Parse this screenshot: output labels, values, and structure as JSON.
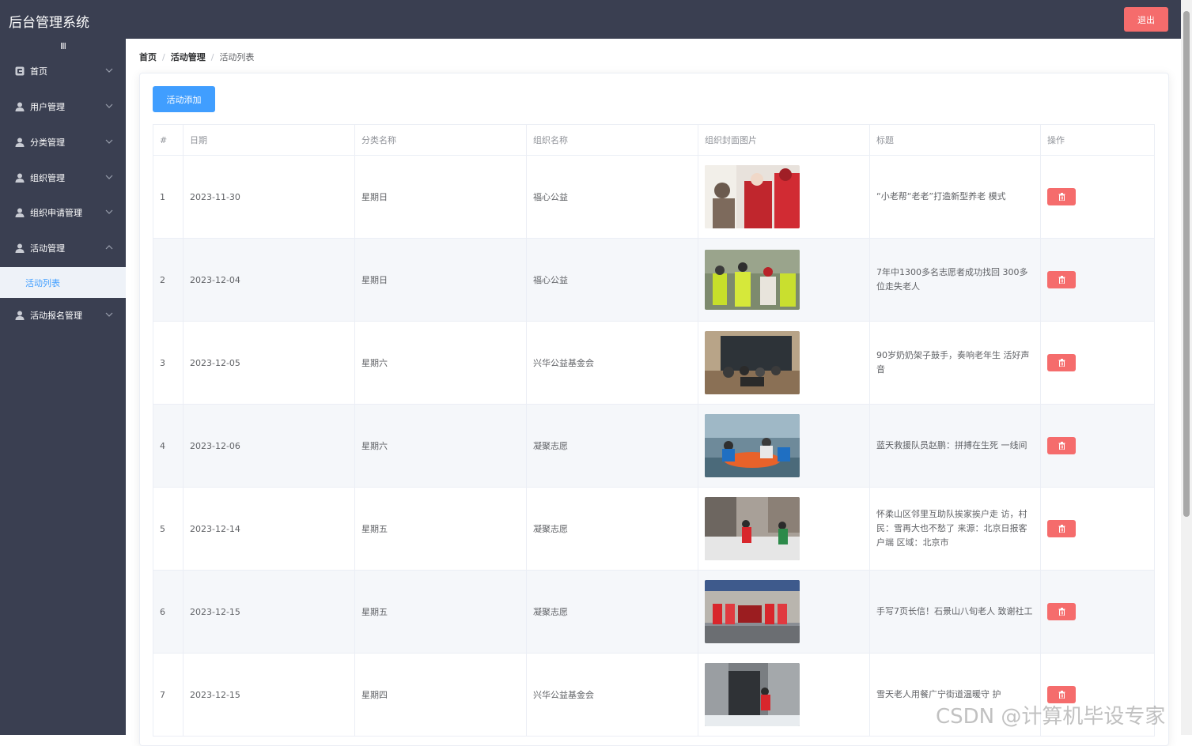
{
  "header": {
    "title": "后台管理系统",
    "logout_label": "退出"
  },
  "sidebar": {
    "toggle_label": "III",
    "items": [
      {
        "label": "首页",
        "icon": "home-icon"
      },
      {
        "label": "用户管理",
        "icon": "user-icon"
      },
      {
        "label": "分类管理",
        "icon": "user-icon"
      },
      {
        "label": "组织管理",
        "icon": "user-icon"
      },
      {
        "label": "组织申请管理",
        "icon": "user-icon"
      },
      {
        "label": "活动管理",
        "icon": "user-icon",
        "expanded": true
      },
      {
        "label": "活动报名管理",
        "icon": "user-icon"
      }
    ],
    "active_subitem": "活动列表"
  },
  "breadcrumb": {
    "home": "首页",
    "section": "活动管理",
    "current": "活动列表",
    "separator": "/"
  },
  "toolbar": {
    "add_label": "活动添加"
  },
  "table": {
    "headers": [
      "#",
      "日期",
      "分类名称",
      "组织名称",
      "组织封面图片",
      "标题",
      "操作"
    ],
    "rows": [
      {
        "index": "1",
        "date": "2023-11-30",
        "category": "星期日",
        "org": "福心公益",
        "title": "“小老帮“老老”打造新型养老 模式"
      },
      {
        "index": "2",
        "date": "2023-12-04",
        "category": "星期日",
        "org": "福心公益",
        "title": "7年中1300多名志愿者成功找回 300多位走失老人"
      },
      {
        "index": "3",
        "date": "2023-12-05",
        "category": "星期六",
        "org": "兴华公益基金会",
        "title": "90岁奶奶架子鼓手，奏响老年生 活好声音"
      },
      {
        "index": "4",
        "date": "2023-12-06",
        "category": "星期六",
        "org": "凝聚志愿",
        "title": "蓝天救援队员赵鹏：拼搏在生死 一线间"
      },
      {
        "index": "5",
        "date": "2023-12-14",
        "category": "星期五",
        "org": "凝聚志愿",
        "title": "怀柔山区邻里互助队挨家挨户走 访，村民：雪再大也不愁了 来源：北京日报客户端 区域：北京市"
      },
      {
        "index": "6",
        "date": "2023-12-15",
        "category": "星期五",
        "org": "凝聚志愿",
        "title": "手写7页长信！石景山八旬老人 致谢社工"
      },
      {
        "index": "7",
        "date": "2023-12-15",
        "category": "星期四",
        "org": "兴华公益基金会",
        "title": "雪天老人用餐广宁街道温暖守 护"
      }
    ]
  },
  "watermark": "CSDN @计算机毕设专家",
  "colors": {
    "sidebar_bg": "#3a3f51",
    "primary": "#409eff",
    "danger": "#f56c6c"
  }
}
